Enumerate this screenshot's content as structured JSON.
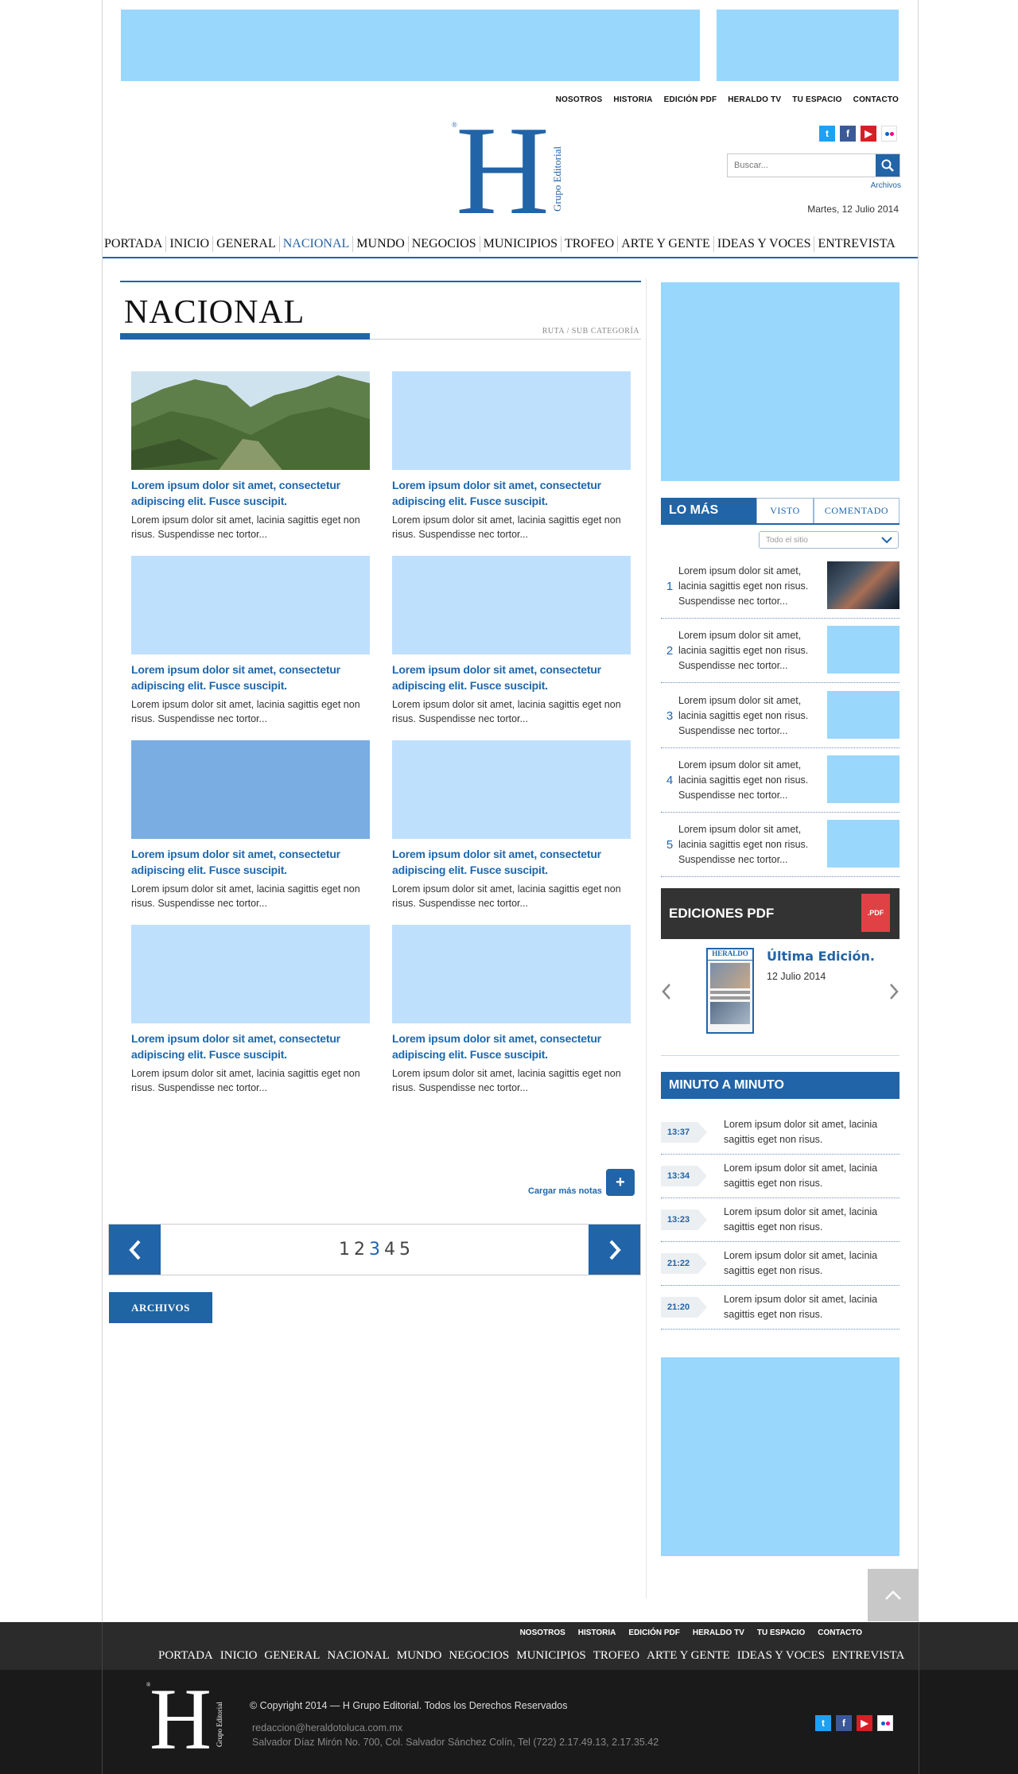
{
  "top_nav": [
    "NOSOTROS",
    "HISTORIA",
    "EDICIÓN PDF",
    "HERALDO TV",
    "TU ESPACIO",
    "CONTACTO"
  ],
  "search": {
    "placeholder": "Buscar..."
  },
  "archivos_link": "Archivos",
  "date": "Martes, 12 Julio 2014",
  "main_nav": {
    "items": [
      "PORTADA",
      "INICIO",
      "GENERAL",
      "NACIONAL",
      "MUNDO",
      "NEGOCIOS",
      "MUNICIPIOS",
      "TROFEO",
      "ARTE Y GENTE",
      "IDEAS Y VOCES",
      "ENTREVISTA"
    ],
    "active": "NACIONAL"
  },
  "section": {
    "title": "NACIONAL",
    "breadcrumb": "RUTA / SUB CATEGORÍA"
  },
  "articles": [
    {
      "title": "Lorem ipsum dolor sit amet, consectetur adipiscing elit. Fusce suscipit.",
      "excerpt": "Lorem ipsum dolor sit amet,   lacinia sagittis eget non risus.  Suspendisse nec tortor...",
      "thumb": "photo"
    },
    {
      "title": "Lorem ipsum dolor sit amet, consectetur adipiscing elit. Fusce suscipit.",
      "excerpt": "Lorem ipsum dolor sit amet,   lacinia sagittis eget non risus.  Suspendisse nec tortor...",
      "thumb": "placeholder"
    },
    {
      "title": "Lorem ipsum dolor sit amet, consectetur adipiscing elit. Fusce suscipit.",
      "excerpt": "Lorem ipsum dolor sit amet,   lacinia sagittis eget non risus.  Suspendisse nec tortor...",
      "thumb": "placeholder"
    },
    {
      "title": "Lorem ipsum dolor sit amet, consectetur adipiscing elit. Fusce suscipit.",
      "excerpt": "Lorem ipsum dolor sit amet,   lacinia sagittis eget non risus.  Suspendisse nec tortor...",
      "thumb": "placeholder"
    },
    {
      "title": "Lorem ipsum dolor sit amet, consectetur adipiscing elit. Fusce suscipit.",
      "excerpt": "Lorem ipsum dolor sit amet,   lacinia sagittis eget non risus.  Suspendisse nec tortor...",
      "thumb": "dark"
    },
    {
      "title": "Lorem ipsum dolor sit amet, consectetur adipiscing elit. Fusce suscipit.",
      "excerpt": "Lorem ipsum dolor sit amet,   lacinia sagittis eget non risus.  Suspendisse nec tortor...",
      "thumb": "placeholder"
    },
    {
      "title": "Lorem ipsum dolor sit amet, consectetur adipiscing elit. Fusce suscipit.",
      "excerpt": "Lorem ipsum dolor sit amet,   lacinia sagittis eget non risus.  Suspendisse nec tortor...",
      "thumb": "placeholder"
    },
    {
      "title": "Lorem ipsum dolor sit amet, consectetur adipiscing elit. Fusce suscipit.",
      "excerpt": "Lorem ipsum dolor sit amet,   lacinia sagittis eget non risus.  Suspendisse nec tortor...",
      "thumb": "placeholder"
    }
  ],
  "load_more": "Cargar más notas",
  "pagination": {
    "pages": [
      "1",
      "2",
      "3",
      "4",
      "5"
    ],
    "current": "3"
  },
  "archive_button": "ARCHIVOS",
  "lo_mas": {
    "tabs": [
      "LO MÁS",
      "VISTO",
      "COMENTADO"
    ],
    "filter": "Todo el sitio",
    "items": [
      {
        "rank": "1",
        "text": "Lorem ipsum dolor sit amet, lacinia sagittis eget non risus. Suspendisse nec tortor...",
        "thumb": "photo"
      },
      {
        "rank": "2",
        "text": "Lorem ipsum dolor sit amet, lacinia sagittis eget non risus. Suspendisse nec tortor...",
        "thumb": "placeholder"
      },
      {
        "rank": "3",
        "text": "Lorem ipsum dolor sit amet, lacinia sagittis eget non risus. Suspendisse nec tortor...",
        "thumb": "placeholder"
      },
      {
        "rank": "4",
        "text": "Lorem ipsum dolor sit amet, lacinia sagittis eget non risus. Suspendisse nec tortor...",
        "thumb": "placeholder"
      },
      {
        "rank": "5",
        "text": "Lorem ipsum dolor sit amet, lacinia sagittis eget non risus. Suspendisse nec tortor...",
        "thumb": "placeholder"
      }
    ]
  },
  "pdf": {
    "header": "EDICIONES PDF",
    "icon_label": ".PDF",
    "cover_masthead": "HERALDO",
    "latest_title": "Última Edición.",
    "latest_date": "12 Julio 2014"
  },
  "minuto": {
    "header": "MINUTO A MINUTO",
    "items": [
      {
        "time": "13:37",
        "text": "Lorem ipsum dolor sit amet,  lacinia sagittis eget non risus."
      },
      {
        "time": "13:34",
        "text": "Lorem ipsum dolor sit amet,  lacinia sagittis eget non risus."
      },
      {
        "time": "13:23",
        "text": "Lorem ipsum dolor sit amet,  lacinia sagittis eget non risus."
      },
      {
        "time": "21:22",
        "text": "Lorem ipsum dolor sit amet,  lacinia sagittis eget non risus."
      },
      {
        "time": "21:20",
        "text": "Lorem ipsum dolor sit amet,  lacinia sagittis eget non risus."
      }
    ]
  },
  "logo": {
    "letter": "H",
    "text": "Grupo Editorial",
    "mark": "®"
  },
  "footer": {
    "top_nav": [
      "NOSOTROS",
      "HISTORIA",
      "EDICIÓN PDF",
      "HERALDO TV",
      "TU ESPACIO",
      "CONTACTO"
    ],
    "main_nav": [
      "PORTADA",
      "INICIO",
      "GENERAL",
      "NACIONAL",
      "MUNDO",
      "NEGOCIOS",
      "MUNICIPIOS",
      "TROFEO",
      "ARTE Y GENTE",
      "IDEAS Y VOCES",
      "ENTREVISTA"
    ],
    "copyright": "© Copyright 2014 — H Grupo Editorial. Todos los Derechos Reservados",
    "email": "redaccion@heraldotoluca.com.mx",
    "address": "Salvador Díaz Mirón No. 700, Col. Salvador Sánchez Colín, Tel (722) 2.17.49.13, 2.17.35.42"
  },
  "colors": {
    "brand_blue": "#2164a8",
    "ad_placeholder": "#99d7fd",
    "thumb_placeholder": "#bfe0fd",
    "footer_dark": "#2b2b2b",
    "footer_darker": "#1a1a1a",
    "pdf_red": "#e04144"
  },
  "icons": {
    "social": [
      "twitter-icon",
      "facebook-icon",
      "youtube-icon",
      "flickr-icon"
    ],
    "search": "search-icon",
    "scroll_top": "chevron-up-icon"
  }
}
